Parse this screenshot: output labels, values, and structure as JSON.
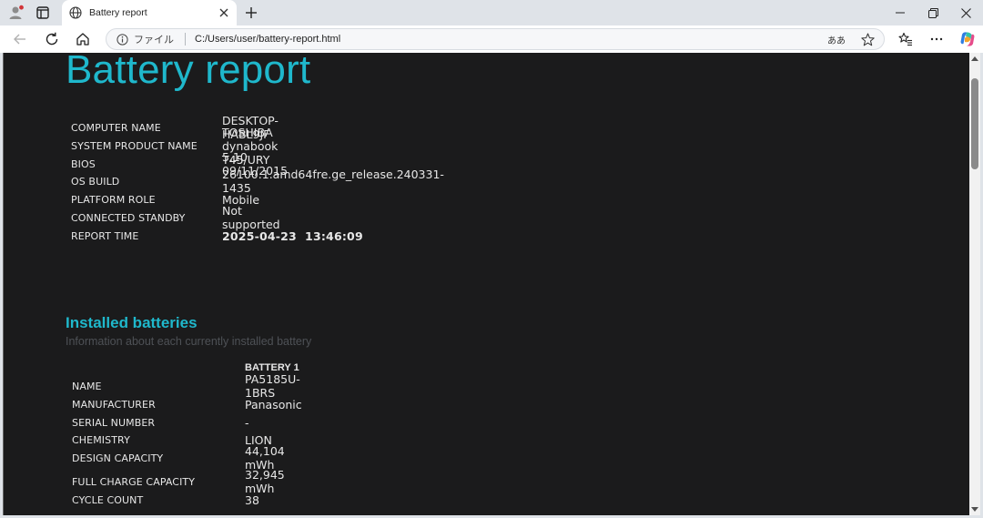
{
  "browser": {
    "tab_title": "Battery report",
    "address_scheme": "ファイル",
    "address_url": "C:/Users/user/battery-report.html",
    "read_aloud_label": "ああ"
  },
  "report": {
    "title": "Battery report",
    "system_info": [
      {
        "label": "COMPUTER NAME",
        "value": "DESKTOP-HABL9JF"
      },
      {
        "label": "SYSTEM PRODUCT NAME",
        "value": "TOSHIBA dynabook T45/URY"
      },
      {
        "label": "BIOS",
        "value": "5.10 09/11/2015"
      },
      {
        "label": "OS BUILD",
        "value": "26100.1.amd64fre.ge_release.240331-1435"
      },
      {
        "label": "PLATFORM ROLE",
        "value": "Mobile"
      },
      {
        "label": "CONNECTED STANDBY",
        "value": "Not supported"
      },
      {
        "label": "REPORT TIME",
        "value": "2025-04-23  13:46:09"
      }
    ],
    "installed_batteries": {
      "title": "Installed batteries",
      "subtitle": "Information about each currently installed battery",
      "column_header": "BATTERY 1",
      "rows": [
        {
          "label": "NAME",
          "value": "PA5185U-1BRS"
        },
        {
          "label": "MANUFACTURER",
          "value": "Panasonic"
        },
        {
          "label": "SERIAL NUMBER",
          "value": "-"
        },
        {
          "label": "CHEMISTRY",
          "value": "LION"
        },
        {
          "label": "DESIGN CAPACITY",
          "value": "44,104 mWh"
        },
        {
          "label": "FULL CHARGE CAPACITY",
          "value": "32,945 mWh"
        },
        {
          "label": "CYCLE COUNT",
          "value": "38"
        }
      ]
    }
  },
  "colors": {
    "accent": "#1fb8cc",
    "page_background": "#1b1b1c",
    "text": "#e7e7e7",
    "subtitle": "#4e5156"
  }
}
